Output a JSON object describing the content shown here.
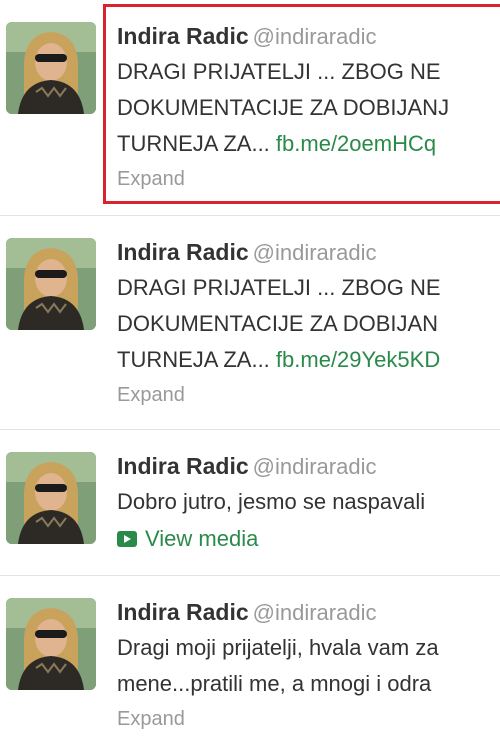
{
  "colors": {
    "link": "#2a8a4a",
    "secondary_text": "#999999",
    "primary_text": "#333333",
    "highlight": "#d9232e",
    "divider": "#e3e3e3"
  },
  "tweets": [
    {
      "fullname": "Indira Radic",
      "username": "@indiraradic",
      "lines": [
        "DRAGI PRIJATELJI ... ZBOG NE",
        "DOKUMENTACIJE ZA DOBIJANJ"
      ],
      "last_line_text": "TURNEJA ZA... ",
      "link": "fb.me/2oemHCq",
      "action": "Expand",
      "highlighted": true
    },
    {
      "fullname": "Indira Radic",
      "username": "@indiraradic",
      "lines": [
        "DRAGI PRIJATELJI ... ZBOG NE",
        "DOKUMENTACIJE ZA DOBIJAN"
      ],
      "last_line_text": "TURNEJA ZA... ",
      "link": "fb.me/29Yek5KD",
      "action": "Expand",
      "highlighted": false
    },
    {
      "fullname": "Indira Radic",
      "username": "@indiraradic",
      "lines": [
        "Dobro jutro, jesmo se naspavali"
      ],
      "action": "View media",
      "action_icon": "video-icon",
      "highlighted": false
    },
    {
      "fullname": "Indira Radic",
      "username": "@indiraradic",
      "lines": [
        "Dragi moji prijatelji, hvala vam za",
        "mene...pratili me, a mnogi i odra"
      ],
      "action": "Expand",
      "highlighted": false
    }
  ]
}
